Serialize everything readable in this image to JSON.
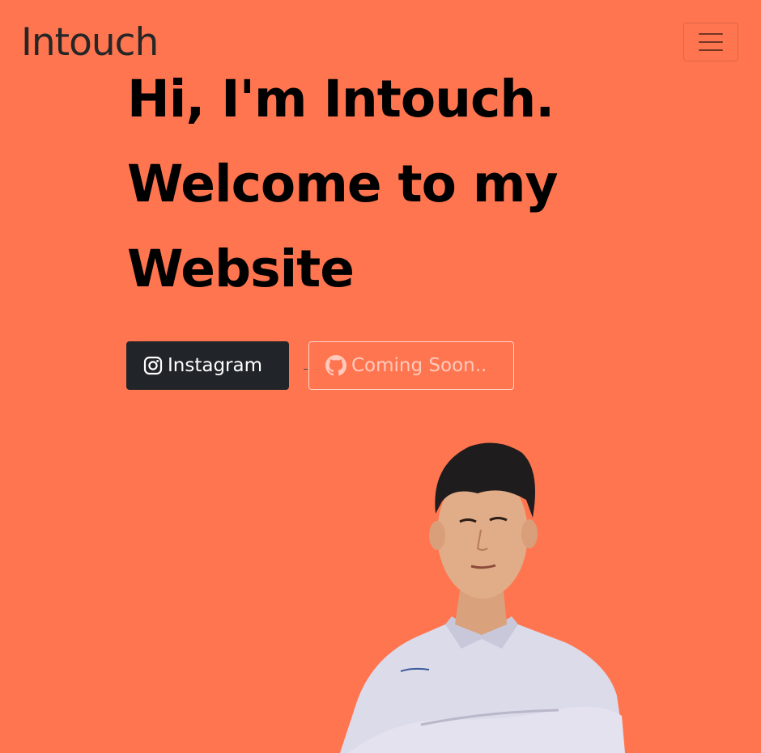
{
  "navbar": {
    "brand": "Intouch",
    "toggler_icon": "hamburger-menu-icon"
  },
  "hero": {
    "line1": "Hi, I'm Intouch.",
    "line2": "Welcome to my",
    "line3": "Website"
  },
  "buttons": {
    "instagram": {
      "label": "Instagram",
      "icon": "instagram-icon"
    },
    "github": {
      "label": "Coming Soon..",
      "icon": "github-icon"
    }
  },
  "colors": {
    "background": "#ff7550",
    "instagram_button": "#212529",
    "text": "#000000"
  }
}
